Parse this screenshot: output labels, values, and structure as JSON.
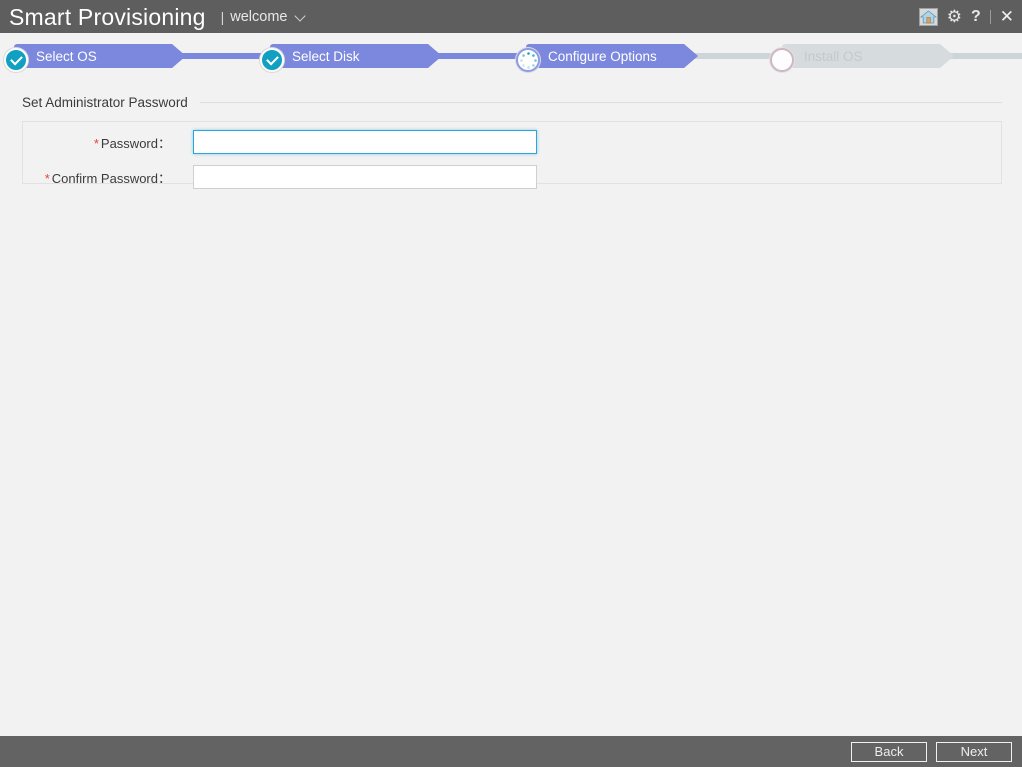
{
  "titlebar": {
    "app_title": "Smart Provisioning",
    "separator": "|",
    "user_label": "welcome",
    "caret_icon": "chevron-down-icon",
    "tools": {
      "home_icon": "home-icon",
      "gear_label": "⚙",
      "help_label": "?",
      "close_label": "✕"
    },
    "bg_color": "#5e5e5e"
  },
  "steps": {
    "items": [
      {
        "label": "Select OS",
        "state": "done"
      },
      {
        "label": "Select Disk",
        "state": "done"
      },
      {
        "label": "Configure Options",
        "state": "current"
      },
      {
        "label": "Install OS",
        "state": "pending"
      }
    ],
    "active_color": "#7b88dd",
    "inactive_color": "#d6dcde",
    "done_circle_color": "#11a0c2",
    "connector_done_color": "#7b88dd",
    "connector_todo_color": "#ccd5d8"
  },
  "form": {
    "section_title": "Set Administrator Password",
    "required_marker": "*",
    "fields": [
      {
        "label": "Password：",
        "value": "",
        "placeholder": "",
        "required": true,
        "focused": true
      },
      {
        "label": "Confirm Password：",
        "value": "",
        "placeholder": "",
        "required": true,
        "focused": false
      }
    ],
    "focus_color": "#29a8dd",
    "required_color": "#e8413c"
  },
  "footer": {
    "back_label": "Back",
    "next_label": "Next",
    "bg_color": "#636363"
  }
}
